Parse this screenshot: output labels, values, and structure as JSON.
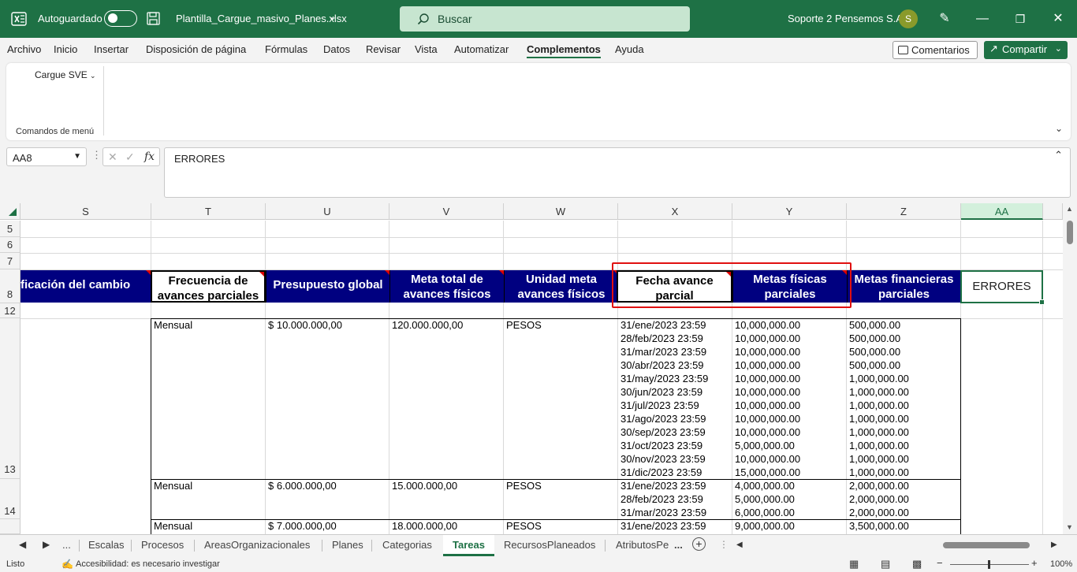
{
  "titlebar": {
    "autosave_label": "Autoguardado",
    "filename": "Plantilla_Cargue_masivo_Planes.xlsx",
    "search_placeholder": "Buscar",
    "user_name": "Soporte 2 Pensemos S.A.",
    "avatar_initial": "S"
  },
  "menu": {
    "items": [
      "Archivo",
      "Inicio",
      "Insertar",
      "Disposición de página",
      "Fórmulas",
      "Datos",
      "Revisar",
      "Vista",
      "Automatizar",
      "Complementos",
      "Ayuda"
    ],
    "active": "Complementos",
    "comments_label": "Comentarios",
    "share_label": "Compartir"
  },
  "ribbon": {
    "button_label": "Cargue SVE",
    "group_label": "Comandos de menú"
  },
  "formula_bar": {
    "name_box": "AA8",
    "content": "ERRORES"
  },
  "columns": [
    "S",
    "T",
    "U",
    "V",
    "W",
    "X",
    "Y",
    "Z",
    "AA"
  ],
  "selected_column": "AA",
  "rows": [
    "5",
    "6",
    "7",
    "8",
    "12",
    "13",
    "14"
  ],
  "header_row": {
    "S": "ficación del cambio",
    "T": "Frecuencia de avances parciales",
    "U": "Presupuesto global",
    "V": "Meta total de avances físicos",
    "W": "Unidad meta avances físicos",
    "X": "Fecha avance parcial",
    "Y": "Metas físicas parciales",
    "Z": "Metas financieras parciales",
    "AA": "ERRORES"
  },
  "data_rows": [
    {
      "row": "13",
      "T": "Mensual",
      "U": "$ 10.000.000,00",
      "V": "120.000.000,00",
      "W": "PESOS",
      "X": "31/ene/2023 23:59\n28/feb/2023 23:59\n31/mar/2023 23:59\n30/abr/2023 23:59\n31/may/2023 23:59\n30/jun/2023 23:59\n31/jul/2023 23:59\n31/ago/2023 23:59\n30/sep/2023 23:59\n31/oct/2023 23:59\n30/nov/2023 23:59\n31/dic/2023 23:59",
      "Y": "10,000,000.00\n10,000,000.00\n10,000,000.00\n10,000,000.00\n10,000,000.00\n10,000,000.00\n10,000,000.00\n10,000,000.00\n10,000,000.00\n5,000,000.00\n10,000,000.00\n15,000,000.00",
      "Z": "500,000.00\n500,000.00\n500,000.00\n500,000.00\n1,000,000.00\n1,000,000.00\n1,000,000.00\n1,000,000.00\n1,000,000.00\n1,000,000.00\n1,000,000.00\n1,000,000.00"
    },
    {
      "row": "14",
      "T": "Mensual",
      "U": "$ 6.000.000,00",
      "V": "15.000.000,00",
      "W": "PESOS",
      "X": "31/ene/2023 23:59\n28/feb/2023 23:59\n31/mar/2023 23:59",
      "Y": "4,000,000.00\n5,000,000.00\n6,000,000.00",
      "Z": "2,000,000.00\n2,000,000.00\n2,000,000.00"
    },
    {
      "row": "",
      "T": "Mensual",
      "U": "$ 7.000.000,00",
      "V": "18.000.000,00",
      "W": "PESOS",
      "X": "31/ene/2023 23:59",
      "Y": "9,000,000.00",
      "Z": "3,500,000.00"
    }
  ],
  "sheet_tabs": [
    "...",
    "Escalas",
    "Procesos",
    "AreasOrganizacionales",
    "Planes",
    "Categorias",
    "Tareas",
    "RecursosPlaneados",
    "AtributosPe",
    "..."
  ],
  "active_tab": "Tareas",
  "status": {
    "ready": "Listo",
    "accessibility": "Accesibilidad: es necesario investigar",
    "zoom": "100%"
  },
  "colors": {
    "excel_green": "#1e7145",
    "header_navy": "#000080",
    "highlight_red": "#e01010"
  }
}
